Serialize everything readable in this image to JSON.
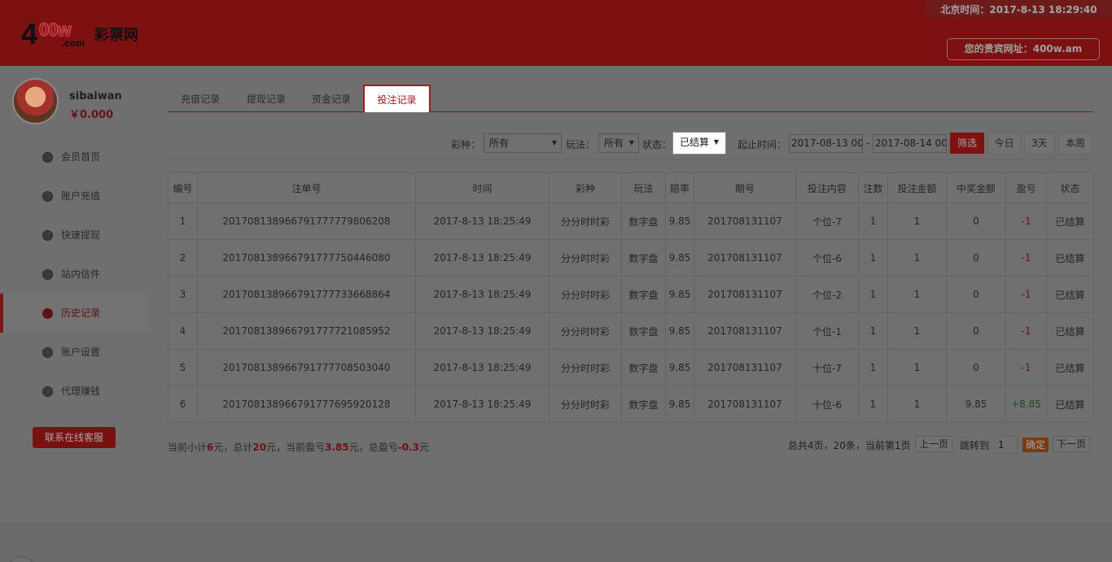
{
  "header": {
    "logo_digit": "4",
    "logo_letters": "00w",
    "logo_domain": ".com",
    "logo_name": "彩票网",
    "clock_text": "北京时间：2017-8-13 18:29:40",
    "vip_url_text": "您的贵宾网址：400w.am"
  },
  "user": {
    "name": "sibaiwan",
    "balance": "￥0.000"
  },
  "sidebar": {
    "items": [
      {
        "label": "会员首页",
        "icon": "home-icon"
      },
      {
        "label": "账户充值",
        "icon": "wallet-icon"
      },
      {
        "label": "快速提现",
        "icon": "withdraw-icon"
      },
      {
        "label": "站内信件",
        "icon": "mail-icon"
      },
      {
        "label": "历史记录",
        "icon": "history-icon",
        "active": true
      },
      {
        "label": "账户设置",
        "icon": "settings-icon"
      },
      {
        "label": "代理赚钱",
        "icon": "agent-icon"
      }
    ],
    "service_button": "联系在线客服"
  },
  "tabs": [
    {
      "label": "充值记录"
    },
    {
      "label": "提现记录"
    },
    {
      "label": "资金记录"
    },
    {
      "label": "投注记录",
      "active": true
    }
  ],
  "filter": {
    "lottery_label": "彩种：",
    "lottery_value": "所有",
    "play_label": "玩法：",
    "play_value": "所有",
    "status_label": "状态：",
    "status_value": "已结算",
    "date_label": "起止时间：",
    "date_from": "2017-08-13 00:",
    "date_sep": "-",
    "date_to": "2017-08-14 00:",
    "filter_button": "筛选",
    "today_button": "今日",
    "three_days_button": "3天",
    "week_button": "本周"
  },
  "table": {
    "headers": [
      "编号",
      "注单号",
      "时间",
      "彩种",
      "玩法",
      "赔率",
      "期号",
      "投注内容",
      "注数",
      "投注金额",
      "中奖金额",
      "盈亏",
      "状态"
    ],
    "rows": [
      [
        "1",
        "201708138966791777779806208",
        "2017-8-13 18:25:49",
        "分分时时彩",
        "数字盘",
        "9.85",
        "201708131107",
        "个位-7",
        "1",
        "1",
        "0",
        "-1",
        "已结算"
      ],
      [
        "2",
        "201708138966791777750446080",
        "2017-8-13 18:25:49",
        "分分时时彩",
        "数字盘",
        "9.85",
        "201708131107",
        "个位-6",
        "1",
        "1",
        "0",
        "-1",
        "已结算"
      ],
      [
        "3",
        "201708138966791777733668864",
        "2017-8-13 18:25:49",
        "分分时时彩",
        "数字盘",
        "9.85",
        "201708131107",
        "个位-2",
        "1",
        "1",
        "0",
        "-1",
        "已结算"
      ],
      [
        "4",
        "201708138966791777721085952",
        "2017-8-13 18:25:49",
        "分分时时彩",
        "数字盘",
        "9.85",
        "201708131107",
        "个位-1",
        "1",
        "1",
        "0",
        "-1",
        "已结算"
      ],
      [
        "5",
        "201708138966791777708503040",
        "2017-8-13 18:25:49",
        "分分时时彩",
        "数字盘",
        "9.85",
        "201708131107",
        "十位-7",
        "1",
        "1",
        "0",
        "-1",
        "已结算"
      ],
      [
        "6",
        "201708138966791777695920128",
        "2017-8-13 18:25:49",
        "分分时时彩",
        "数字盘",
        "9.85",
        "201708131107",
        "十位-6",
        "1",
        "1",
        "9.85",
        "+8.85",
        "已结算"
      ]
    ]
  },
  "summary": {
    "t1": "当前小计",
    "v1": "6",
    "t2": "元，总计",
    "v2": "20",
    "t3": "元，当前盈亏",
    "v3": "3.85",
    "t4": "元，总盈亏",
    "v4": "-0.3",
    "t5": "元"
  },
  "pager": {
    "info": "总共4页，20条，当前第1页",
    "prev": "上一页",
    "jump_label": "跳转到",
    "jump_value": "1",
    "ok": "确定",
    "next": "下一页"
  },
  "colors": {
    "header_bg": "#7d1010",
    "accent": "#b21717",
    "overlay_bg": "#6f6f6f"
  }
}
